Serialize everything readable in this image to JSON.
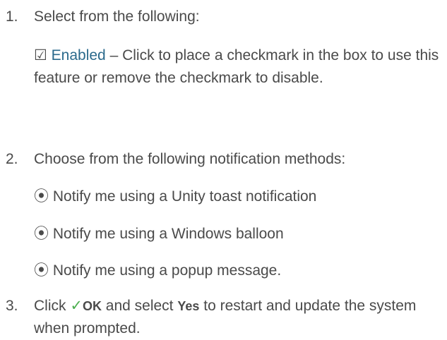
{
  "steps": [
    {
      "number": "1.",
      "text": "Select from the following:",
      "option": {
        "icon": "checkbox-checked-icon",
        "glyph": "☑",
        "label": "Enabled",
        "description": " – Click to place a checkmark in the box to use this feature or remove the checkmark to disable."
      }
    },
    {
      "number": "2.",
      "text": "Choose from the following notification methods:",
      "options": [
        {
          "icon": "radio-selected-icon",
          "glyph": "⦿",
          "label": "Notify me using a Unity toast notification"
        },
        {
          "icon": "radio-selected-icon",
          "glyph": "⦿",
          "label": "Notify me using a Windows balloon"
        },
        {
          "icon": "radio-selected-icon",
          "glyph": "⦿",
          "label": "Notify me using a popup message."
        }
      ]
    },
    {
      "number": "3.",
      "text_before": "Click ",
      "check_glyph": "✓",
      "ok_label": "OK",
      "text_middle": " and select ",
      "yes_label": "Yes",
      "text_after": " to restart and update the system when prompted."
    }
  ],
  "colors": {
    "text": "#4a4a4a",
    "accent": "#2b6a8c",
    "check": "#4caf50"
  }
}
